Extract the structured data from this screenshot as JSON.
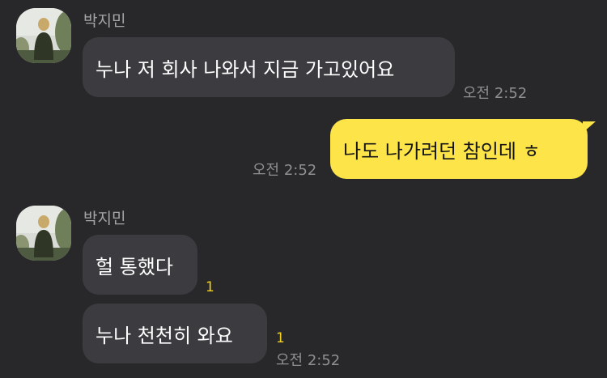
{
  "chat": {
    "sender_name": "박지민",
    "messages": [
      {
        "text": "누나 저 회사 나와서 지금 가고있어요",
        "time": "오전 2:52"
      },
      {
        "text": "나도 나가려던 참인데 ㅎ",
        "time": "오전 2:52"
      },
      {
        "text": "헐 통했다",
        "unread": "1"
      },
      {
        "text": "누나 천천히 와요",
        "unread": "1",
        "time": "오전 2:52"
      }
    ]
  },
  "colors": {
    "background": "#28282a",
    "incoming_bubble": "#3c3c40",
    "outgoing_bubble": "#fde449",
    "unread_count": "#f3d11c",
    "timestamp": "#8f8f93",
    "sender_name": "#a6a6a9"
  },
  "icons": {
    "avatar": "profile-photo-person-in-park"
  }
}
